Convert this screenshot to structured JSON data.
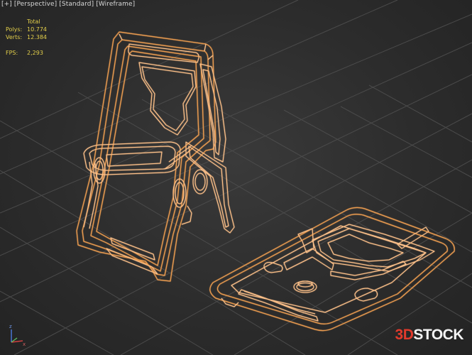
{
  "viewport_label": {
    "plus": "[+]",
    "view": "[Perspective]",
    "shading_mode": "[Standard]",
    "display": "[Wireframe]"
  },
  "stats": {
    "header": "Total",
    "polys_label": "Polys:",
    "polys_value": "10.774",
    "verts_label": "Verts:",
    "verts_value": "12.384",
    "fps_label": "FPS:",
    "fps_value": "2,293"
  },
  "gizmo": {
    "z": "z",
    "x": "x"
  },
  "watermark": {
    "prefix": "3D",
    "suffix": "STOCK"
  },
  "colors": {
    "wire_primary": "#ffc28a",
    "wire_secondary": "#e89a4f",
    "grid": "#4a4a4a",
    "stats_text": "#e3cf4a",
    "watermark_red": "#e23a2c"
  }
}
